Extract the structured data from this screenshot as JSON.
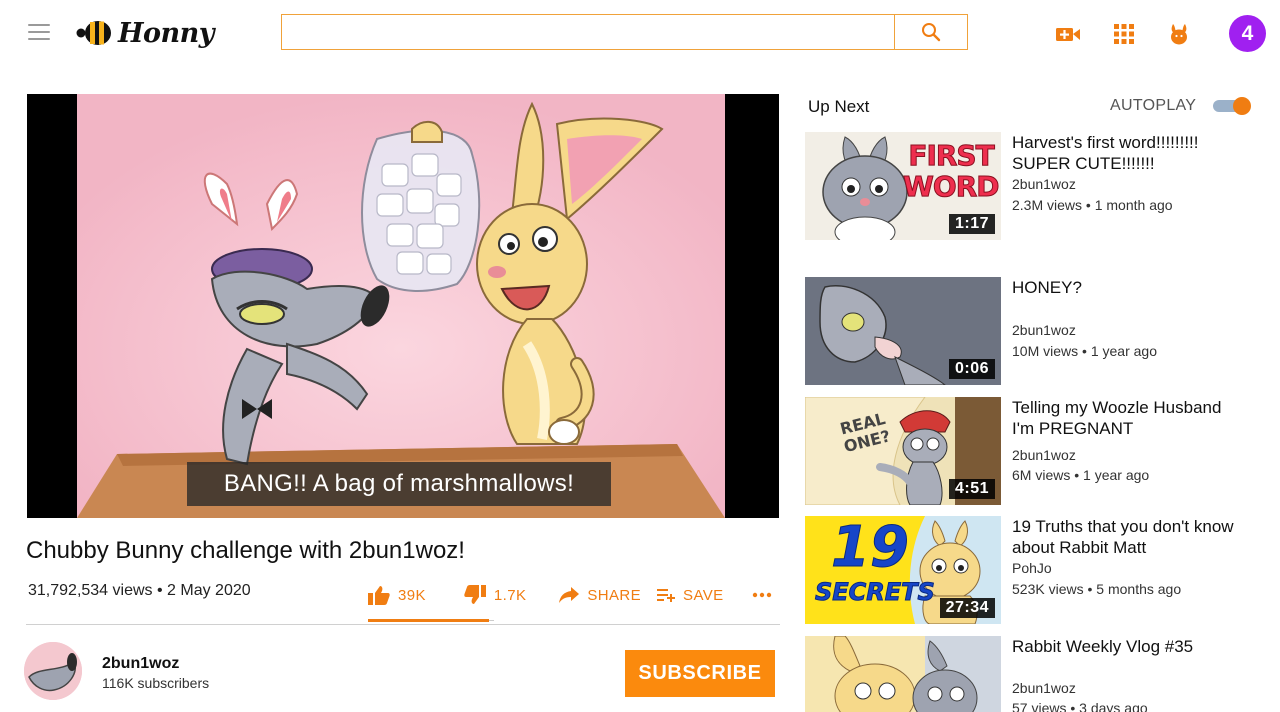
{
  "header": {
    "logo_text": "Honny",
    "search_placeholder": "",
    "avatar_initial": "4",
    "icons": [
      "menu-icon",
      "search-icon",
      "create-video-icon",
      "apps-grid-icon",
      "notifications-bunny-icon"
    ]
  },
  "player": {
    "caption": "BANG!! A bag of marshmallows!"
  },
  "video": {
    "title": "Chubby Bunny challenge with 2bun1woz!",
    "views": "31,792,534 views",
    "date": "2 May 2020",
    "likes": "39K",
    "dislikes": "1.7K",
    "share_label": "SHARE",
    "save_label": "SAVE",
    "like_ratio": 0.96
  },
  "channel": {
    "name": "2bun1woz",
    "subscribers": "116K subscribers",
    "subscribe_label": "SUBSCRIBE"
  },
  "sidebar": {
    "up_next_label": "Up Next",
    "autoplay_label": "AUTOPLAY",
    "autoplay_on": true,
    "items": [
      {
        "title": "Harvest's first word!!!!!!!!! SUPER CUTE!!!!!!!",
        "channel": "2bun1woz",
        "views": "2.3M views",
        "age": "1 month ago",
        "duration": "1:17",
        "thumb_text": "FIRST WORD!"
      },
      {
        "title": "HONEY?",
        "channel": "2bun1woz",
        "views": "10M views",
        "age": "1 year ago",
        "duration": "0:06",
        "thumb_text": ""
      },
      {
        "title": "Telling my Woozle Husband I'm PREGNANT",
        "channel": "2bun1woz",
        "views": "6M views",
        "age": "1 year ago",
        "duration": "4:51",
        "thumb_text": "REAL ONE?"
      },
      {
        "title": "19 Truths that you don't know about Rabbit Matt",
        "channel": "PohJo",
        "views": "523K views",
        "age": "5 months ago",
        "duration": "27:34",
        "thumb_text": "19 SECRETS"
      },
      {
        "title": "Rabbit Weekly Vlog #35",
        "channel": "2bun1woz",
        "views": "57 views",
        "age": "3 days ago",
        "duration": "",
        "thumb_text": ""
      }
    ]
  },
  "colors": {
    "accent": "#f07d12",
    "subscribe": "#fb8a0d",
    "avatar": "#a020f0",
    "search_border": "#f0a23a"
  }
}
